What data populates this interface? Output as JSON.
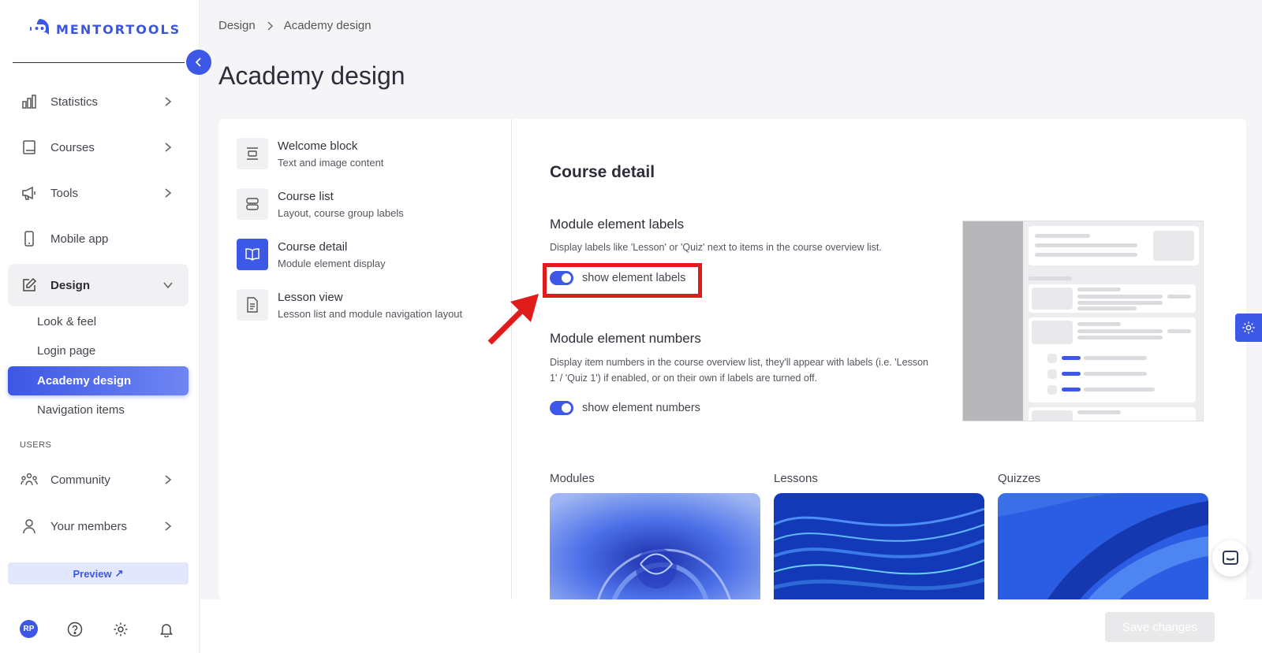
{
  "brand": {
    "name": "MENTORTOOLS",
    "accent": "#3d57e6"
  },
  "sidebar": {
    "items": [
      {
        "label": "Statistics",
        "icon": "bar-chart-icon"
      },
      {
        "label": "Courses",
        "icon": "book-icon"
      },
      {
        "label": "Tools",
        "icon": "megaphone-icon"
      },
      {
        "label": "Mobile app",
        "icon": "phone-icon"
      },
      {
        "label": "Design",
        "icon": "edit-icon"
      }
    ],
    "design_sub": [
      "Look & feel",
      "Login page",
      "Academy design",
      "Navigation items"
    ],
    "section_users": "USERS",
    "users_items": [
      {
        "label": "Community",
        "icon": "community-icon"
      },
      {
        "label": "Your members",
        "icon": "user-icon"
      }
    ],
    "preview_label": "Preview",
    "avatar_initials": "RP"
  },
  "breadcrumb": {
    "parent": "Design",
    "current": "Academy design"
  },
  "page_title": "Academy design",
  "design_menu": [
    {
      "title": "Welcome block",
      "sub": "Text and image content"
    },
    {
      "title": "Course list",
      "sub": "Layout, course group labels"
    },
    {
      "title": "Course detail",
      "sub": "Module element display"
    },
    {
      "title": "Lesson view",
      "sub": "Lesson list and module navigation layout"
    }
  ],
  "detail": {
    "title": "Course detail",
    "labels_section": {
      "title": "Module element labels",
      "desc": "Display labels like 'Lesson' or 'Quiz' next to items in the course overview list.",
      "toggle_label": "show element labels"
    },
    "numbers_section": {
      "title": "Module element numbers",
      "desc": "Display item numbers in the course overview list, they'll appear with labels (i.e. 'Lesson 1' / 'Quiz 1') if enabled, or on their own if labels are turned off.",
      "toggle_label": "show element numbers"
    },
    "thumbs": [
      "Modules",
      "Lessons",
      "Quizzes"
    ]
  },
  "footer": {
    "save_label": "Save changes"
  }
}
